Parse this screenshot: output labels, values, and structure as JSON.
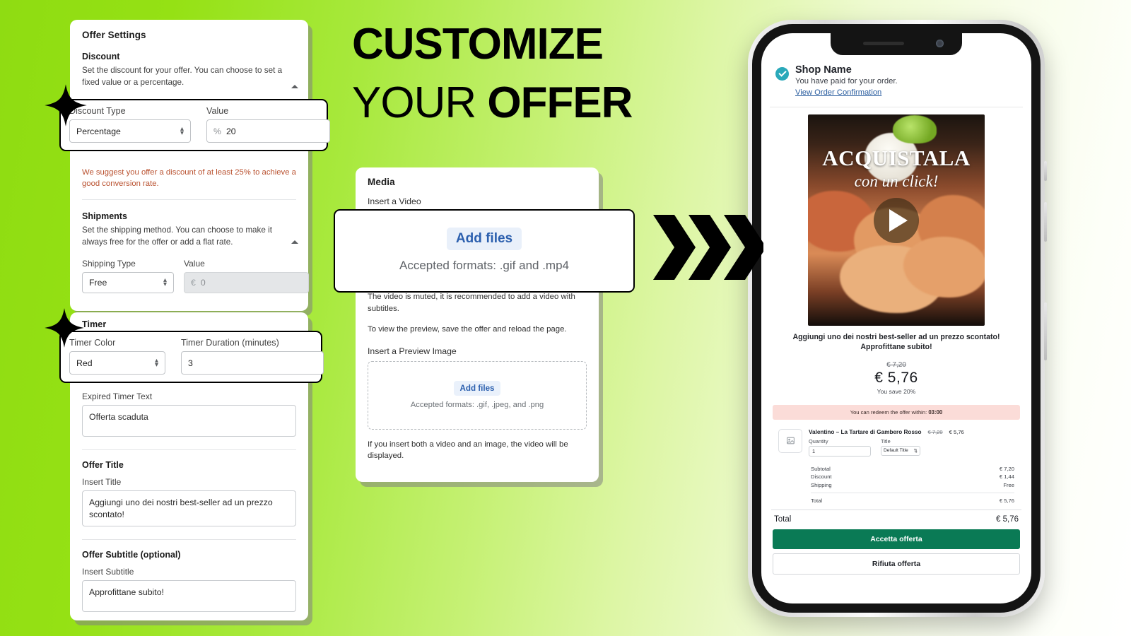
{
  "headline": {
    "line1": "CUSTOMIZE",
    "line2_light": "YOUR ",
    "line2_bold": "OFFER"
  },
  "offer_settings": {
    "card_title": "Offer Settings",
    "discount": {
      "heading": "Discount",
      "description": "Set the discount for your offer. You can choose to set a fixed value or a percentage.",
      "type_label": "Discount Type",
      "type_value": "Percentage",
      "value_label": "Value",
      "value_prefix": "%",
      "value": "20",
      "warning": "We suggest you offer a discount of at least 25% to achieve a good conversion rate."
    },
    "shipments": {
      "heading": "Shipments",
      "description": "Set the shipping method. You can choose to make it always free for the offer or add a flat rate.",
      "type_label": "Shipping Type",
      "type_value": "Free",
      "value_label": "Value",
      "value_prefix": "€",
      "value": "0"
    }
  },
  "timer_card": {
    "card_title": "Timer",
    "color_label": "Timer Color",
    "color_value": "Red",
    "duration_label": "Timer Duration (minutes)",
    "duration_value": "3",
    "expired_label": "Expired Timer Text",
    "expired_value": "Offerta scaduta",
    "offer_title_heading": "Offer Title",
    "insert_title_label": "Insert Title",
    "insert_title_value": "Aggiungi uno dei nostri best-seller ad un prezzo scontato!",
    "offer_subtitle_heading": "Offer Subtitle (optional)",
    "insert_subtitle_label": "Insert Subtitle",
    "insert_subtitle_value": "Approfittane subito!"
  },
  "media_card": {
    "card_title": "Media",
    "insert_video_label": "Insert a Video",
    "video_add_files": "Add files",
    "video_formats": "Accepted formats: .gif and .mp4",
    "note_muted": "The video is muted, it is recommended to add a video with subtitles.",
    "note_preview": "To view the preview, save the offer and reload the page.",
    "insert_preview_label": "Insert a Preview Image",
    "image_add_files": "Add files",
    "image_formats": "Accepted formats: .gif, .jpeg, and .png",
    "note_both": "If you insert both a video and an image, the video will be displayed."
  },
  "phone": {
    "shop_name": "Shop Name",
    "paid_text": "You have paid for your order.",
    "view_link": "View Order Confirmation",
    "video_title": "ACQUISTALA",
    "video_subtitle": "con un click!",
    "offer_title": "Aggiungi uno dei nostri best-seller ad un prezzo scontato!",
    "offer_subtitle": "Approfittane subito!",
    "old_price": "€ 7,20",
    "new_price": "€  5,76",
    "you_save": "You save  20%",
    "timer_text": "You can redeem the offer within:",
    "timer_value": "03:00",
    "item": {
      "name": "Valentino – La Tartare di Gambero Rosso",
      "old_price": "€ 7,20",
      "new_price": "€ 5,76",
      "quantity_label": "Quantity",
      "quantity_value": "1",
      "title_label": "Title",
      "title_value": "Default Title"
    },
    "totals": [
      {
        "label": "Subtotal",
        "value": "€ 7,20"
      },
      {
        "label": "Discount",
        "value": "€ 1,44"
      },
      {
        "label": "Shipping",
        "value": "Free"
      }
    ],
    "total_small_label": "Total",
    "total_small_value": "€ 5,76",
    "grand_label": "Total",
    "grand_value": "€ 5,76",
    "accept_button": "Accetta offerta",
    "refuse_button": "Rifiuta offerta"
  },
  "colors": {
    "background_green": "#95e114",
    "accent_blue": "#2b5fae",
    "warning_red": "#b9512f",
    "accept_green": "#0a7a55",
    "timer_banner": "#fbdcd8",
    "check_teal": "#2aa9ba"
  }
}
